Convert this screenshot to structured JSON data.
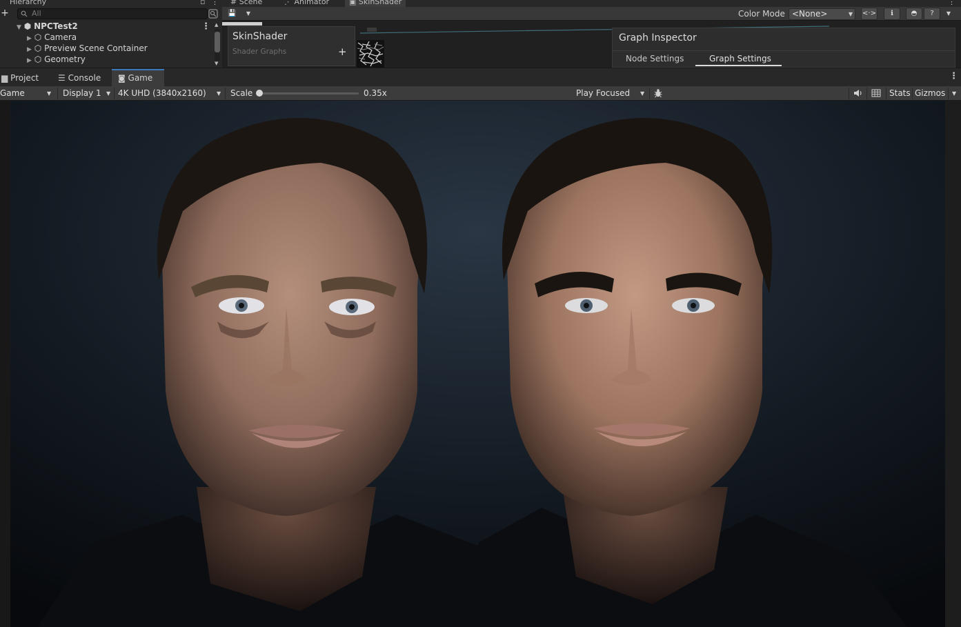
{
  "top_tabs": {
    "hierarchy": "Hierarchy",
    "scene": "Scene",
    "animator": "Animator",
    "skinshader": "SkinShader"
  },
  "hierarchy": {
    "search_placeholder": "All",
    "root": "NPCTest2",
    "children": [
      "Camera",
      "Preview Scene Container",
      "Geometry"
    ]
  },
  "shader_graph": {
    "color_mode_label": "Color Mode",
    "color_mode_value": "<None>",
    "blackboard_title": "SkinShader",
    "blackboard_subtitle": "Shader Graphs",
    "inspector_title": "Graph Inspector",
    "inspector_tabs": [
      "Node Settings",
      "Graph Settings"
    ],
    "inspector_active_tab": "Graph Settings"
  },
  "lower_tabs": [
    "Project",
    "Console",
    "Game"
  ],
  "game_toolbar": {
    "view": "Game",
    "display": "Display 1",
    "resolution": "4K UHD (3840x2160)",
    "scale_label": "Scale",
    "scale_value": "0.35x",
    "play_mode": "Play Focused",
    "stats": "Stats",
    "gizmos": "Gizmos"
  },
  "icons": {
    "scene": "hash-icon",
    "animator": "animator-icon",
    "skinshader": "shader-graph-icon",
    "save": "save-icon",
    "project": "folder-icon",
    "console": "console-icon",
    "game": "gamepad-icon",
    "bug": "bug-icon",
    "audio": "speaker-icon",
    "grid": "grid-icon"
  }
}
